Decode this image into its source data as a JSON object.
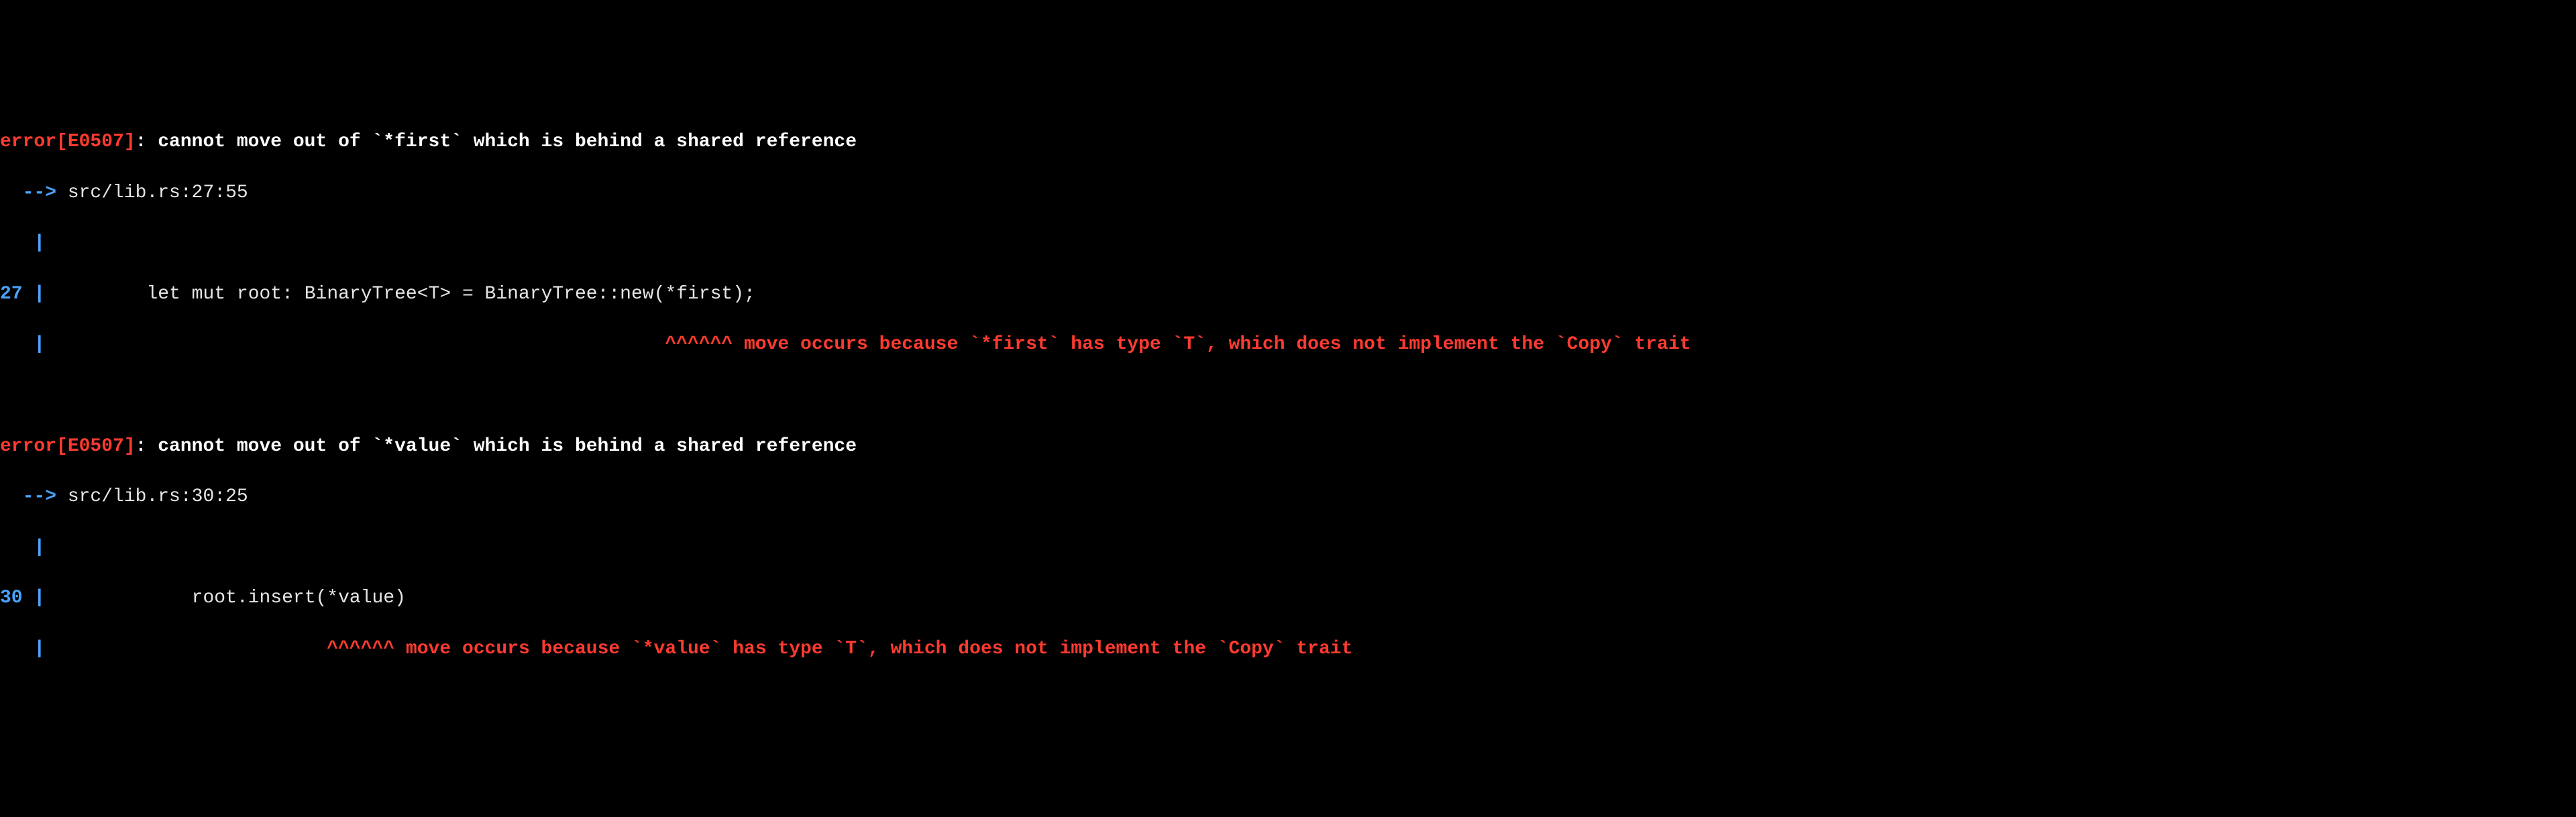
{
  "errors": [
    {
      "header_error": "error[E0507]",
      "header_msg": ": cannot move out of `*first` which is behind a shared reference",
      "arrow": "  --> ",
      "location": "src/lib.rs:27:55",
      "gutter_blank": "   |",
      "line_no": "27 ",
      "gutter_pipe": "|",
      "code_indent": "         ",
      "code": "let mut root: BinaryTree<T> = BinaryTree::new(*first);",
      "underline_pad": "                                                       ",
      "underline_carets": "^^^^^^",
      "underline_msg": " move occurs because `*first` has type `T`, which does not implement the `Copy` trait"
    },
    {
      "header_error": "error[E0507]",
      "header_msg": ": cannot move out of `*value` which is behind a shared reference",
      "arrow": "  --> ",
      "location": "src/lib.rs:30:25",
      "gutter_blank": "   |",
      "line_no": "30 ",
      "gutter_pipe": "|",
      "code_indent": "             ",
      "code": "root.insert(*value)",
      "underline_pad": "                         ",
      "underline_carets": "^^^^^^",
      "underline_msg": " move occurs because `*value` has type `T`, which does not implement the `Copy` trait"
    }
  ]
}
